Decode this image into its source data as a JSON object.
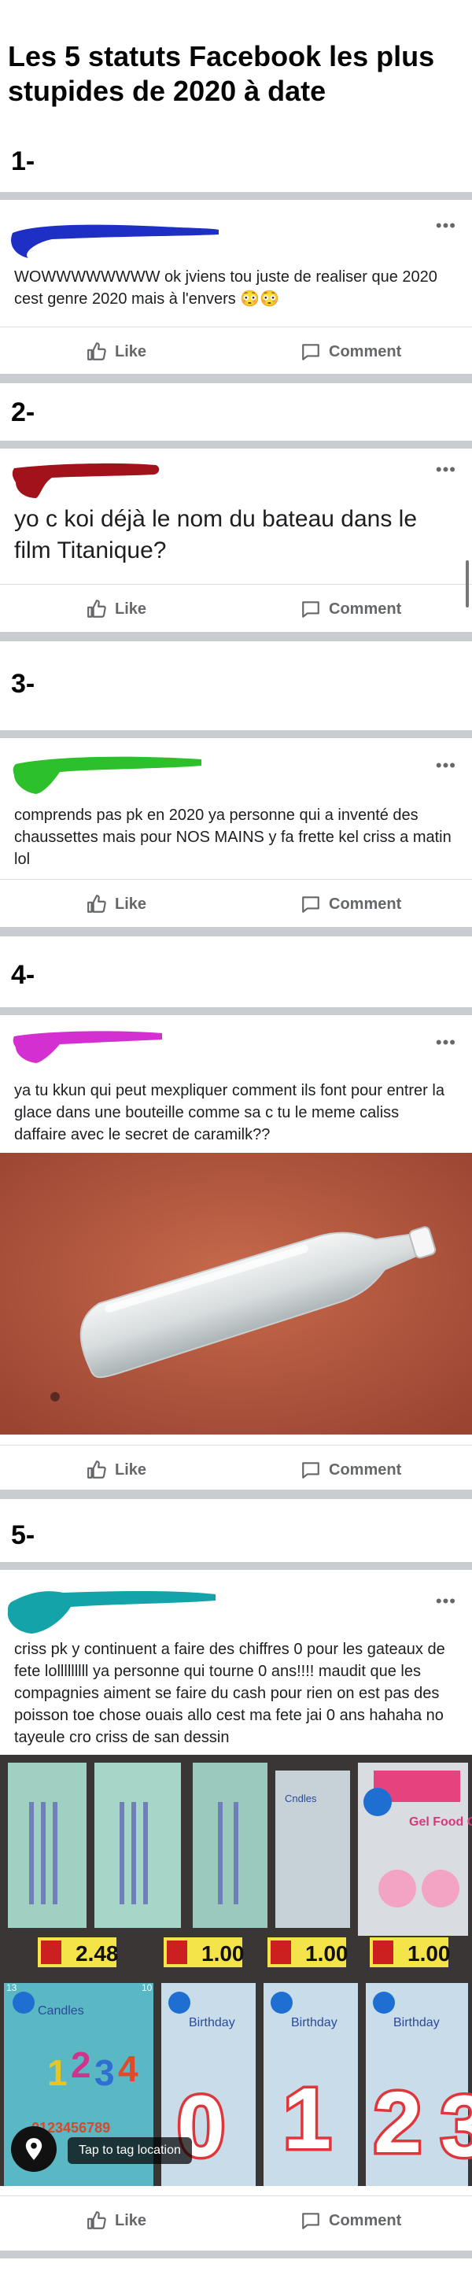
{
  "title": "Les 5 statuts Facebook les plus stupides de 2020 à date",
  "actions": {
    "like": "Like",
    "comment": "Comment"
  },
  "posts": [
    {
      "number": "1-",
      "scribble_color": "#1d2fc4",
      "text": "WOWWWWWWWW ok jviens tou juste de realiser que 2020 cest genre 2020 mais à l'envers 😳😳"
    },
    {
      "number": "2-",
      "scribble_color": "#a1121b",
      "text": "yo c koi déjà le nom du bateau dans le film Titanique?"
    },
    {
      "number": "3-",
      "scribble_color": "#2cc02a",
      "text": "comprends pas pk en 2020 ya personne qui a inventé des chaussettes mais pour NOS MAINS y fa frette kel criss a matin lol"
    },
    {
      "number": "4-",
      "scribble_color": "#d42fd0",
      "text": "ya tu kkun qui peut mexpliquer comment ils font pour entrer la glace dans une bouteille comme sa c tu le meme caliss daffaire avec le secret de caramilk??"
    },
    {
      "number": "5-",
      "scribble_color": "#14a3a8",
      "text": "criss pk y continuent a faire des chiffres 0 pour les gateaux de fete lolllllllll ya personne qui tourne 0 ans!!!! maudit que les compagnies aiment se faire du cash pour rien on est pas des poisson toe chose ouais allo cest ma fete jai 0 ans hahaha no tayeule cro criss de san dessin"
    }
  ],
  "photo5": {
    "tag_location": "Tap to tag location",
    "prices": [
      "2.48",
      "1.00",
      "1.00",
      "1.00"
    ],
    "shelf_labels": [
      "Candles",
      "Birthday",
      "Birthday",
      "Birthday"
    ],
    "package_labels": [
      "Cndles",
      "Gel Food Colors"
    ],
    "candle_digits": [
      "0",
      "1",
      "2",
      "3"
    ],
    "digit_strip": "0123456789",
    "badge": "10",
    "badge2": "13"
  }
}
